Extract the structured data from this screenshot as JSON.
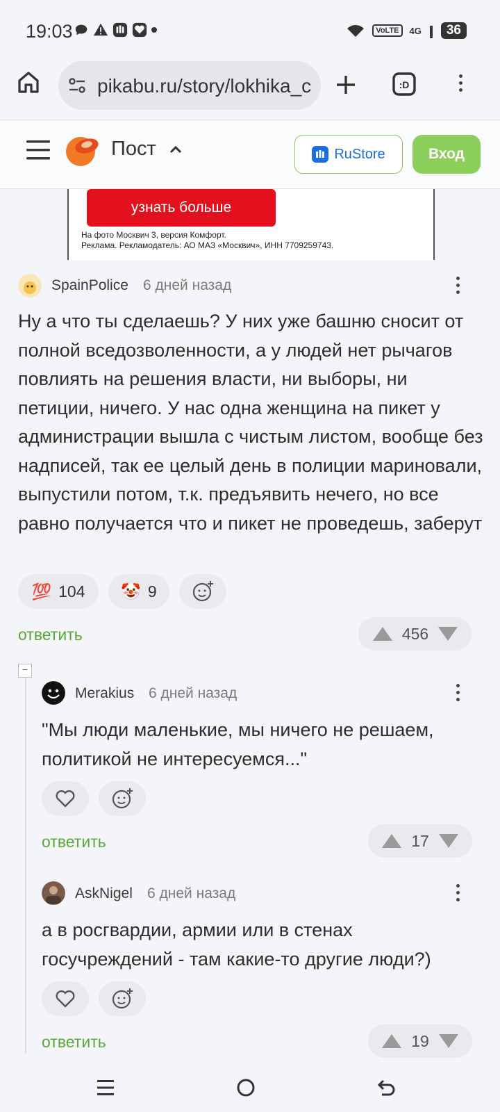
{
  "status_bar": {
    "time": "19:03",
    "volte": "VoLTE",
    "network": "4G",
    "battery": "36"
  },
  "browser": {
    "url": "pikabu.ru/story/lokhika_c"
  },
  "header": {
    "title": "Пост",
    "rustore_label": "RuStore",
    "login_label": "Вход"
  },
  "ad": {
    "button_label": "узнать больше",
    "line1": "На фото Москвич 3, версия Комфорт.",
    "line2": "Реклама. Рекламодатель: АО МАЗ «Москвич», ИНН 7709259743."
  },
  "comments": [
    {
      "user": "SpainPolice",
      "time": "6 дней назад",
      "text": "Ну а что ты сделаешь? У них уже башню сносит от полной вседозволенности, а у людей нет рычагов повлиять на решения власти, ни выборы, ни петиции, ничего. У нас одна женщина на пикет у администрации вышла с чистым листом, вообще без надписей, так ее целый день в полиции мариновали, выпустили потом, т.к. предъявить нечего, но все равно получается что и пикет не проведешь, заберут",
      "reactions": [
        {
          "emoji": "💯",
          "count": "104"
        },
        {
          "emoji": "🤡",
          "count": "9"
        }
      ],
      "reply_label": "ответить",
      "rating": "456"
    },
    {
      "user": "Merakius",
      "time": "6 дней назад",
      "text": "\"Мы люди маленькие, мы ничего не решаем, политикой не интересуемся...\"",
      "reply_label": "ответить",
      "rating": "17"
    },
    {
      "user": "AskNigel",
      "time": "6 дней назад",
      "text": "а в росгвардии, армии или в стенах госучреждений - там какие-то другие люди?)",
      "reply_label": "ответить",
      "rating": "19"
    }
  ],
  "colors": {
    "accent_green": "#5aa738",
    "login_button": "#8bcf5a",
    "ad_red": "#e3101e",
    "rustore_blue": "#1b6fe0"
  }
}
